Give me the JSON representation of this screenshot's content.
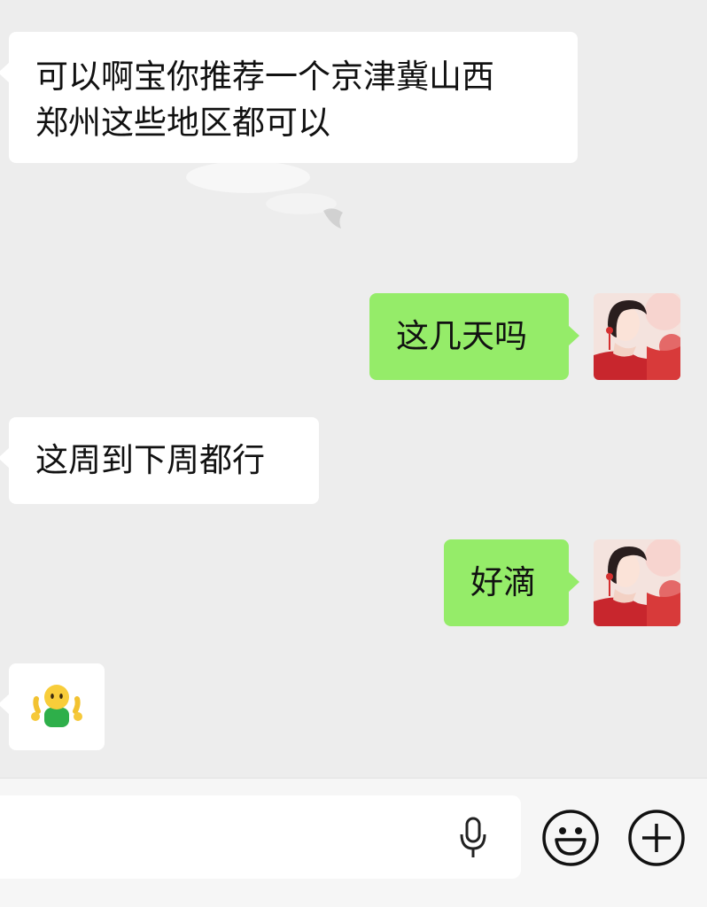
{
  "messages": [
    {
      "id": "m1",
      "side": "incoming",
      "type": "text",
      "lines": [
        "可以啊宝你推荐一个京津冀山西",
        "郑州这些地区都可以"
      ]
    },
    {
      "id": "m2",
      "side": "outgoing",
      "type": "text",
      "text": "这几天吗"
    },
    {
      "id": "m3",
      "side": "incoming",
      "type": "text",
      "text": "这周到下周都行"
    },
    {
      "id": "m4",
      "side": "outgoing",
      "type": "text",
      "text": "好滴"
    },
    {
      "id": "m5",
      "side": "incoming",
      "type": "emoji",
      "icon": "shrug-person-emoji"
    }
  ],
  "input_bar": {
    "value": "",
    "icons": [
      "microphone-icon",
      "emoji-face-icon",
      "plus-circle-icon"
    ]
  },
  "colors": {
    "chat_background": "#ededed",
    "incoming_bubble": "#ffffff",
    "outgoing_bubble": "#95ec69",
    "input_bar_background": "#f6f6f6",
    "icon_color": "#111111"
  }
}
